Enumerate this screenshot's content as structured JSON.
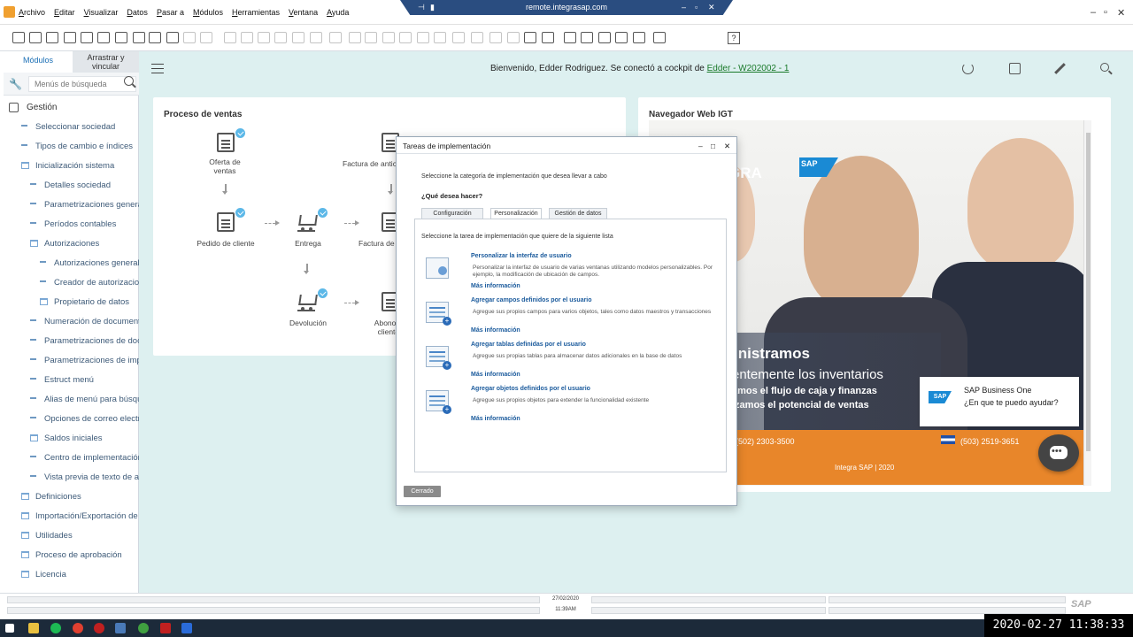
{
  "menubar": {
    "items": [
      "Archivo",
      "Editar",
      "Visualizar",
      "Datos",
      "Pasar a",
      "Módulos",
      "Herramientas",
      "Ventana",
      "Ayuda"
    ],
    "remote_title": "remote.integrasap.com"
  },
  "sidebar": {
    "tab_modules": "Módulos",
    "tab_drag": "Arrastrar y vincular",
    "search_placeholder": "Menús de búsqueda",
    "root_label": "Gestión",
    "items": [
      {
        "label": "Seleccionar sociedad",
        "level": 1,
        "type": "leaf"
      },
      {
        "label": "Tipos de cambio e índices",
        "level": 1,
        "type": "leaf"
      },
      {
        "label": "Inicialización sistema",
        "level": 1,
        "type": "folder"
      },
      {
        "label": "Detalles sociedad",
        "level": 2,
        "type": "leaf"
      },
      {
        "label": "Parametrizaciones generales",
        "level": 2,
        "type": "leaf"
      },
      {
        "label": "Períodos contables",
        "level": 2,
        "type": "leaf"
      },
      {
        "label": "Autorizaciones",
        "level": 2,
        "type": "folder"
      },
      {
        "label": "Autorizaciones generales",
        "level": 3,
        "type": "leaf"
      },
      {
        "label": "Creador de autorizaciones",
        "level": 3,
        "type": "leaf"
      },
      {
        "label": "Propietario de datos",
        "level": 3,
        "type": "folder"
      },
      {
        "label": "Numeración de documentos",
        "level": 2,
        "type": "leaf"
      },
      {
        "label": "Parametrizaciones de documento",
        "level": 2,
        "type": "leaf"
      },
      {
        "label": "Parametrizaciones de impresión",
        "level": 2,
        "type": "leaf"
      },
      {
        "label": "Estruct menú",
        "level": 2,
        "type": "leaf"
      },
      {
        "label": "Alias de menú para búsqueda",
        "level": 2,
        "type": "leaf"
      },
      {
        "label": "Opciones de correo electrónico",
        "level": 2,
        "type": "leaf"
      },
      {
        "label": "Saldos iniciales",
        "level": 2,
        "type": "folder"
      },
      {
        "label": "Centro de implementación",
        "level": 2,
        "type": "leaf"
      },
      {
        "label": "Vista previa de texto de ayuda",
        "level": 2,
        "type": "leaf"
      },
      {
        "label": "Definiciones",
        "level": 1,
        "type": "folder"
      },
      {
        "label": "Importación/Exportación de datos",
        "level": 1,
        "type": "folder"
      },
      {
        "label": "Utilidades",
        "level": 1,
        "type": "folder"
      },
      {
        "label": "Proceso de aprobación",
        "level": 1,
        "type": "folder"
      },
      {
        "label": "Licencia",
        "level": 1,
        "type": "folder"
      }
    ]
  },
  "cockpit": {
    "welcome_text": "Bienvenido, Edder Rodriguez. Se conectó a cockpit de",
    "cockpit_link": "Edder - W202002 - 1"
  },
  "sales_card": {
    "title": "Proceso de ventas",
    "nodes": {
      "quote": "Oferta de ventas",
      "order": "Pedido de cliente",
      "delivery": "Entrega",
      "down_payment": "Factura de anticipo",
      "invoice": "Factura de deudores",
      "return": "Devolución",
      "credit": "Abono de clientes"
    }
  },
  "browser_card": {
    "title": "Navegador Web IGT",
    "brand": "GRA",
    "partner_logo": "SAP",
    "headline1": "inistramos",
    "headline2": "entemente los inventarios",
    "headline3": "amos el flujo de caja y finanzas",
    "headline4": "izamos el potencial de ventas",
    "phone1": "(502) 2303-3500",
    "phone2": "(503) 2519-3651",
    "footer": "Integra SAP | 2020"
  },
  "chat": {
    "title": "SAP Business One",
    "prompt": "¿En que te puedo ayudar?"
  },
  "dialog": {
    "title": "Tareas de implementación",
    "intro": "Seleccione la categoría de implementación que desea llevar a cabo",
    "question": "¿Qué desea hacer?",
    "tabs": [
      "Configuración",
      "Personalización",
      "Gestión de datos"
    ],
    "active_tab": 1,
    "panel_intro": "Seleccione la tarea de implementación que quiere de la siguiente lista",
    "tasks": [
      {
        "title": "Personalizar la interfaz de usuario",
        "desc": "Personalizar la interfaz de usuario de varias ventanas utilizando modelos personalizables. Por ejemplo, la modificación de ubicación de campos.",
        "more": "Más información"
      },
      {
        "title": "Agregar campos definidos por el usuario",
        "desc": "Agregue sus propios campos para varios objetos, tales como datos maestros y transacciones",
        "more": "Más información"
      },
      {
        "title": "Agregar tablas definidas por el usuario",
        "desc": "Agregue sus propias tablas para almacenar datos adicionales en la base de datos",
        "more": "Más información"
      },
      {
        "title": "Agregar objetos definidos por el usuario",
        "desc": "Agregue sus propios objetos para extender la funcionalidad existente",
        "more": "Más información"
      }
    ],
    "close_button": "Cerrado"
  },
  "statusbar": {
    "date": "27/02/2020",
    "time": "11:39AM",
    "logo": "SAP"
  },
  "overlay_timestamp": "2020-02-27 11:38:33"
}
